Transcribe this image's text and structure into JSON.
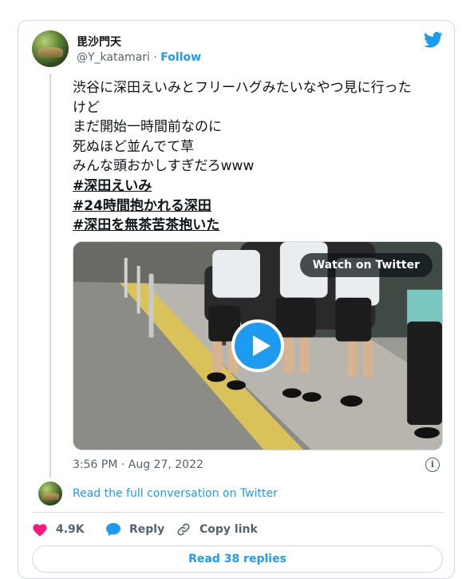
{
  "author": {
    "display_name": "毘沙門天",
    "handle": "@Y_katamari",
    "separator": " · ",
    "follow_label": "Follow"
  },
  "tweet": {
    "lines": [
      "渋谷に深田えいみとフリーハグみたいなやつ見に行った",
      "けど",
      "まだ開始一時間前なのに",
      "死ぬほど並んでて草",
      "みんな頭おかしすぎだろwww"
    ],
    "hashtags": [
      "#深田えいみ",
      "#24時間抱かれる深田",
      "#深田を無茶苦茶抱いた"
    ],
    "timestamp": "3:56 PM · Aug 27, 2022"
  },
  "media": {
    "watch_label": "Watch on Twitter"
  },
  "conversation": {
    "read_full_label": "Read the full conversation on Twitter"
  },
  "actions": {
    "like_count": "4.9K",
    "reply_label": "Reply",
    "copy_link_label": "Copy link",
    "read_replies_label": "Read 38 replies"
  },
  "colors": {
    "brand_blue": "#1d9bf0",
    "like_pink": "#f91880",
    "border": "#cfd9de",
    "muted_text": "#536471"
  },
  "icons": [
    "twitter-bird-icon",
    "play-icon",
    "info-icon",
    "heart-icon",
    "reply-bubble-icon",
    "link-icon"
  ]
}
